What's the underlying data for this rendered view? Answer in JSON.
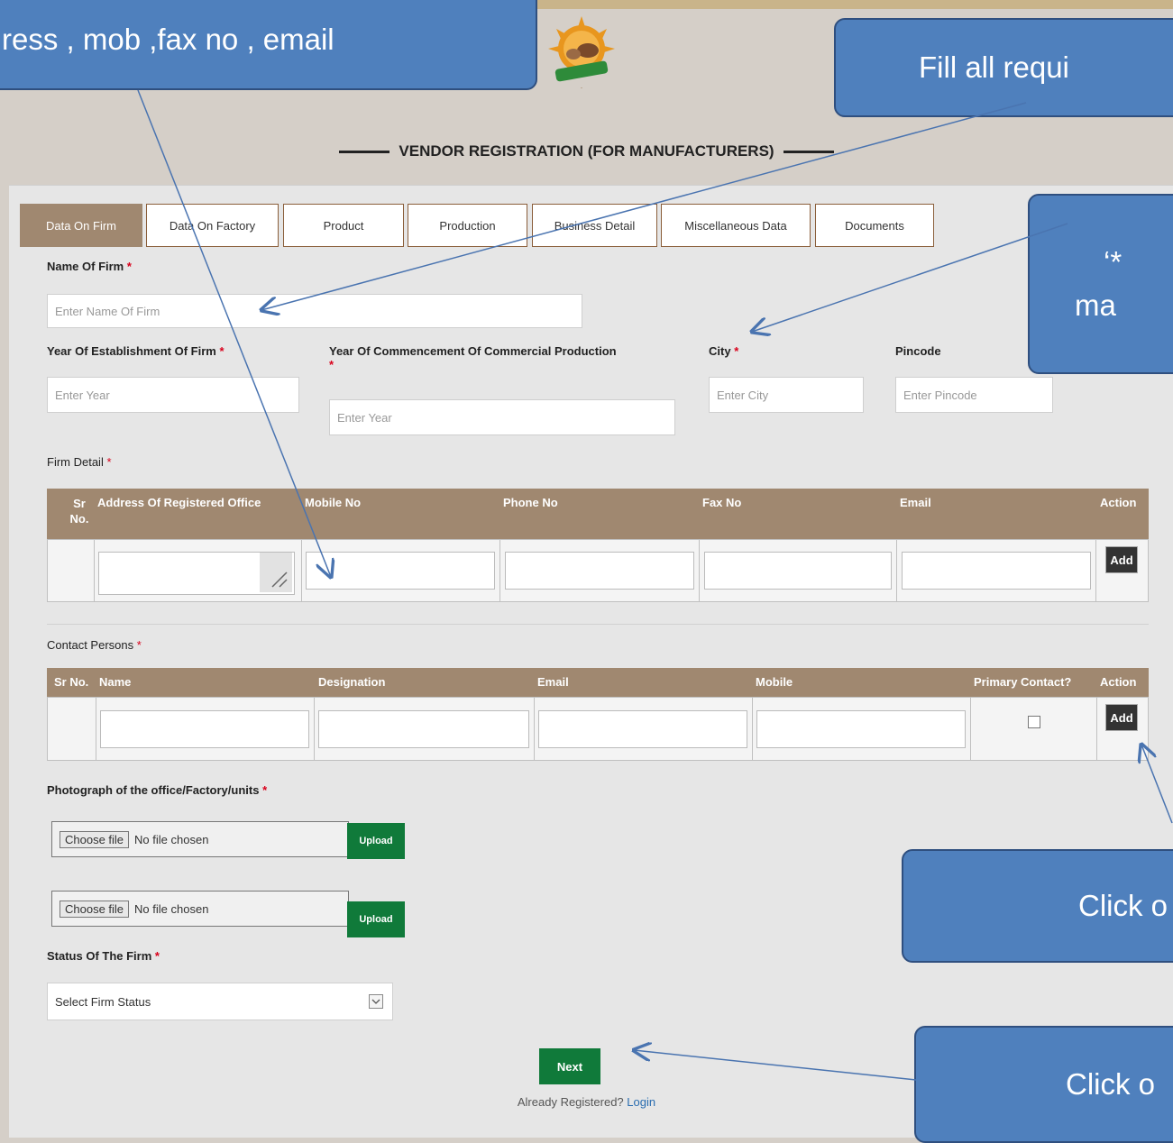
{
  "page_title": "VENDOR REGISTRATION (FOR MANUFACTURERS)",
  "tabs": [
    {
      "label": "Data On Firm",
      "active": true
    },
    {
      "label": "Data On Factory",
      "active": false
    },
    {
      "label": "Product",
      "active": false
    },
    {
      "label": "Production",
      "active": false
    },
    {
      "label": "Business Detail",
      "active": false
    },
    {
      "label": "Miscellaneous Data",
      "active": false
    },
    {
      "label": "Documents",
      "active": false
    }
  ],
  "fields": {
    "name_of_firm": {
      "label": "Name Of Firm",
      "placeholder": "Enter Name Of Firm"
    },
    "year_establishment": {
      "label": "Year Of Establishment Of Firm",
      "placeholder": "Enter Year"
    },
    "year_commencement": {
      "label": "Year Of Commencement Of Commercial Production",
      "placeholder": "Enter Year"
    },
    "city": {
      "label": "City",
      "placeholder": "Enter City"
    },
    "pincode": {
      "label": "Pincode",
      "placeholder": "Enter Pincode"
    }
  },
  "required_mark": "*",
  "firm_detail": {
    "label": "Firm Detail",
    "headers": [
      "Sr No.",
      "Address Of Registered Office",
      "Mobile No",
      "Phone No",
      "Fax No",
      "Email",
      "Action"
    ],
    "add_label": "Add"
  },
  "contact_persons": {
    "label": "Contact Persons",
    "headers": [
      "Sr No.",
      "Name",
      "Designation",
      "Email",
      "Mobile",
      "Primary Contact?",
      "Action"
    ],
    "add_label": "Add"
  },
  "photograph": {
    "label": "Photograph of the office/Factory/units",
    "choose_label": "Choose file",
    "no_file": "No file chosen",
    "upload_label": "Upload"
  },
  "status": {
    "label": "Status Of The Firm",
    "selected": "Select Firm Status"
  },
  "next_label": "Next",
  "already_text": "Already Registered?",
  "login_label": "Login",
  "callouts": {
    "top_left": "ress , mob ,fax no , email",
    "top_right": "Fill all requi",
    "mid_right_line1": "‘*",
    "mid_right_line2": "ma",
    "click_add": "Click o",
    "click_next": "Click o"
  },
  "colors": {
    "tab_active": "#a08870",
    "table_header": "#a08870",
    "button_green": "#107a3a",
    "callout_blue": "#4f80bd",
    "required": "#d9001b"
  },
  "icons": [
    "logo-emblem",
    "resize-handle-icon",
    "dropdown-arrow-icon",
    "checkbox-icon"
  ]
}
